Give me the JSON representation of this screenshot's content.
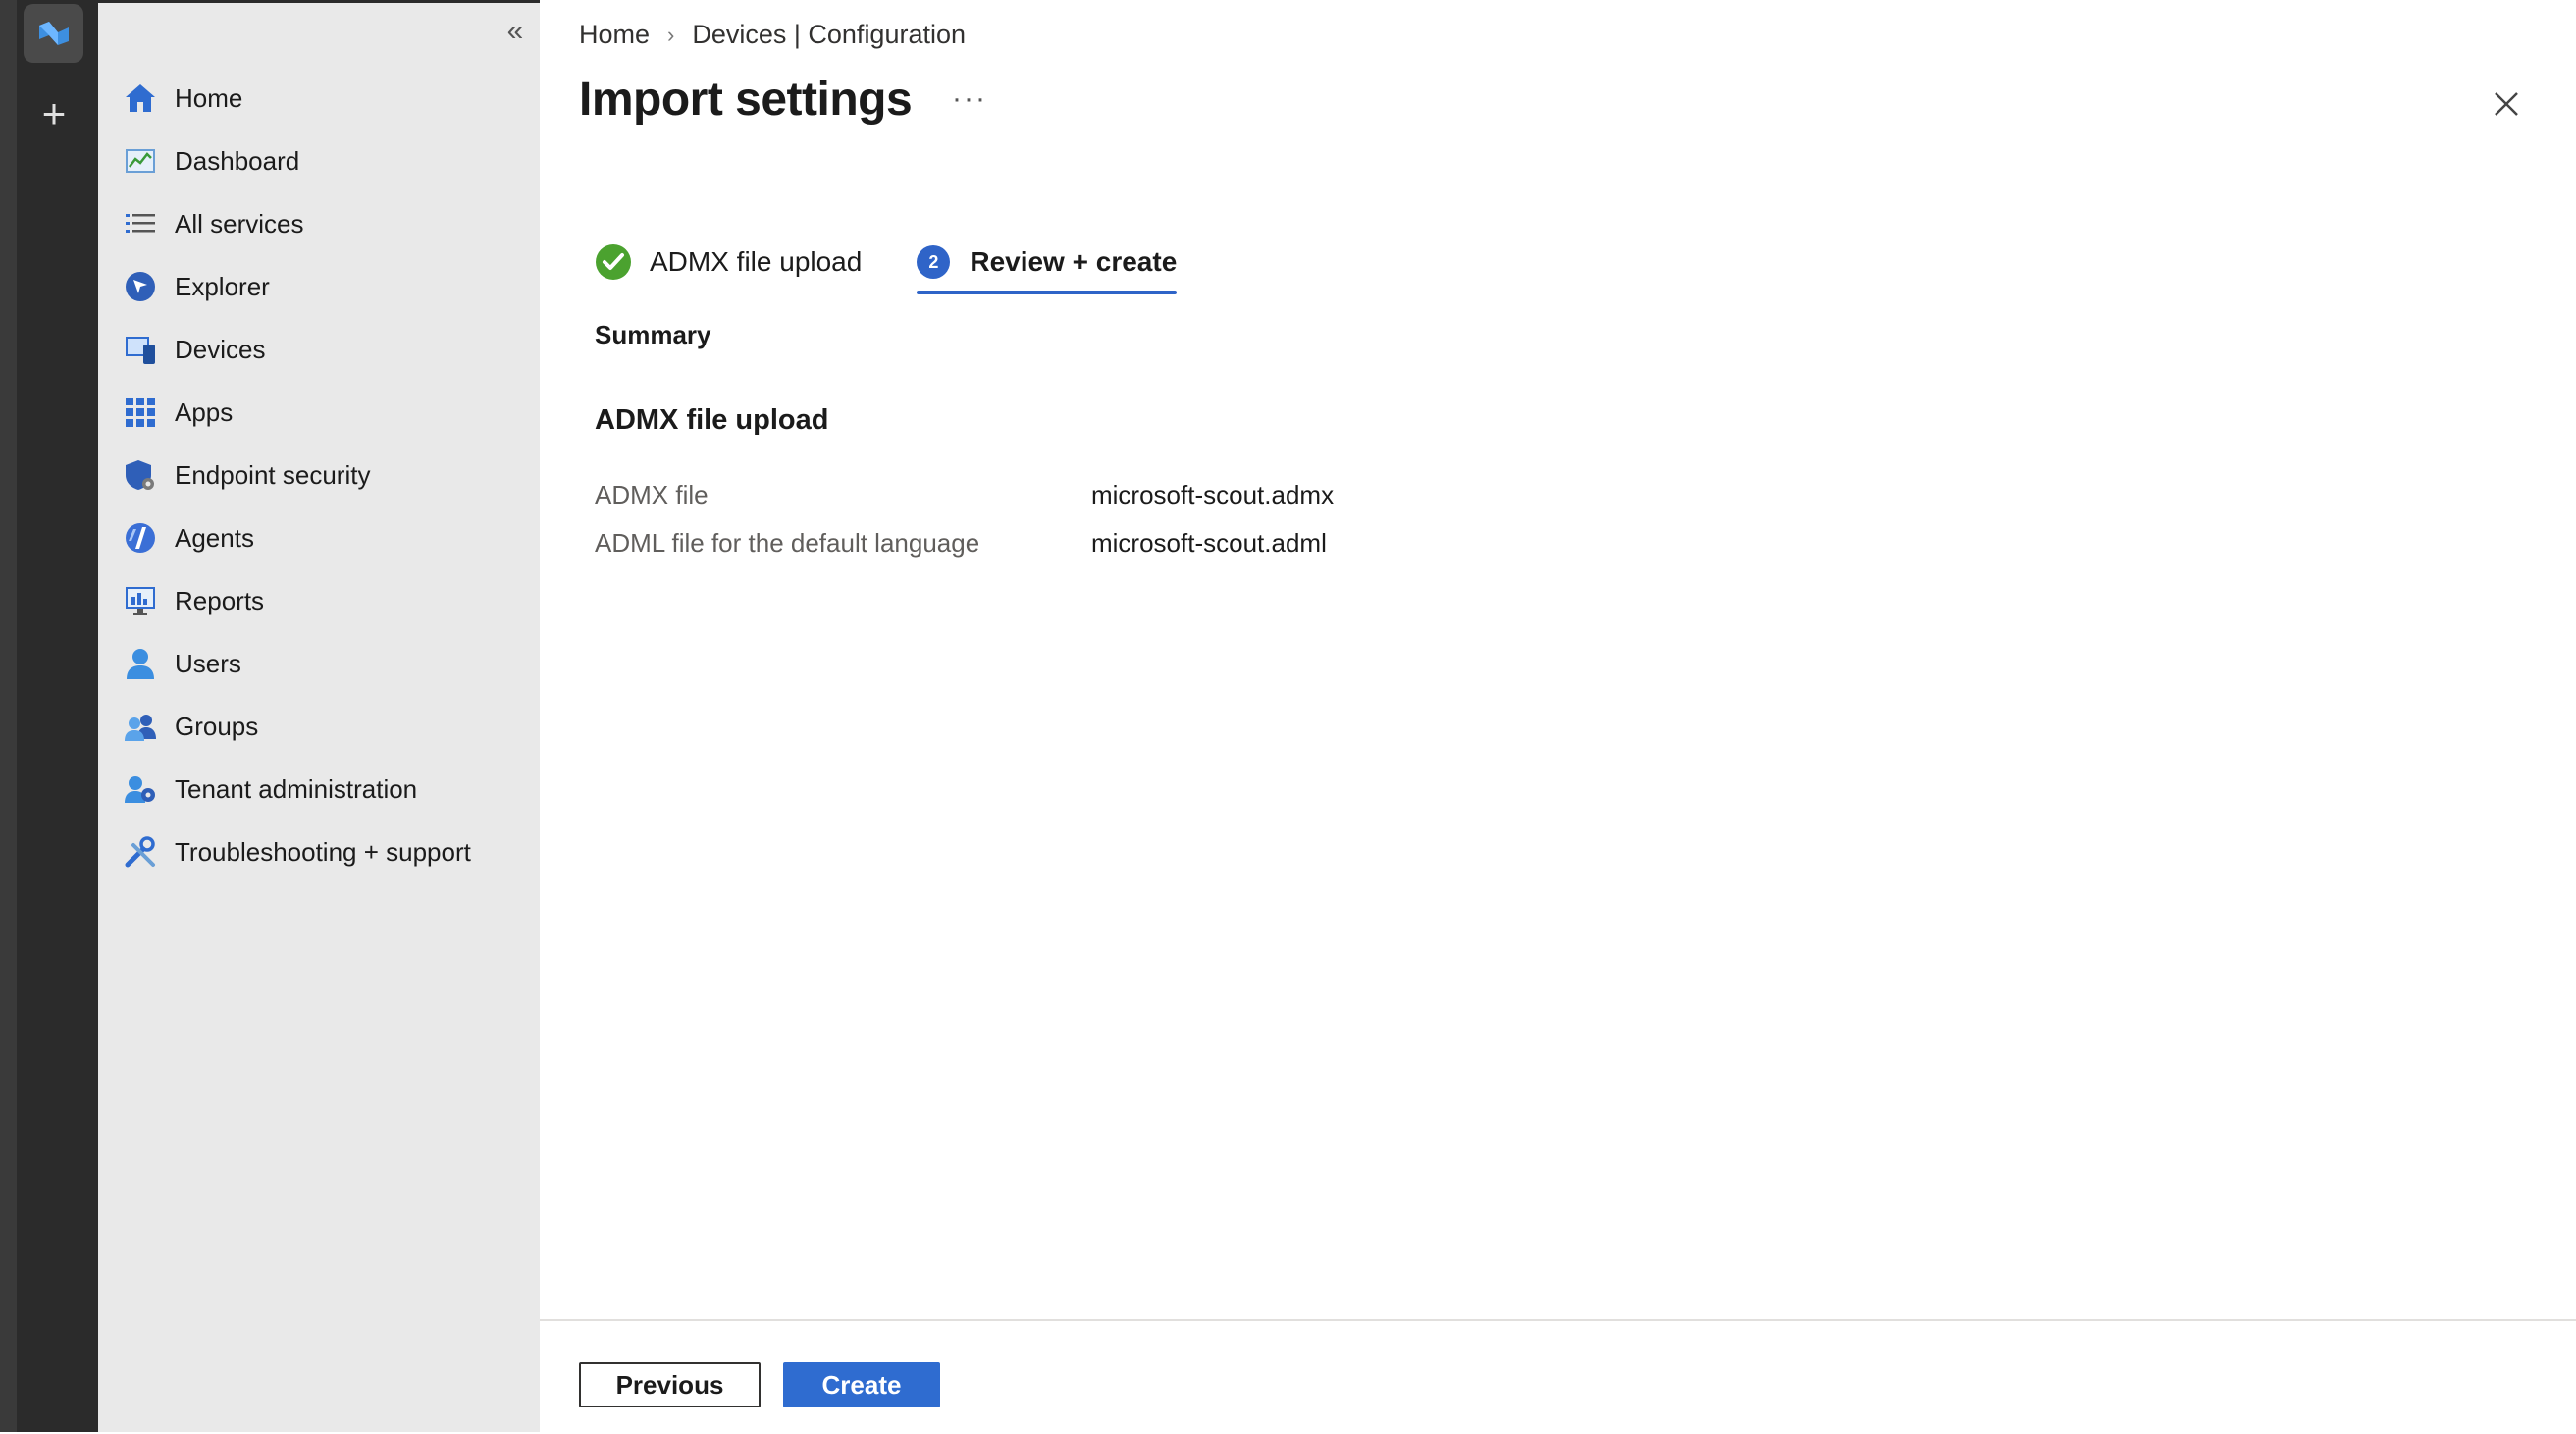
{
  "breadcrumb": {
    "home": "Home",
    "current": "Devices | Configuration"
  },
  "page": {
    "title": "Import settings",
    "more": "···"
  },
  "sidebar": {
    "items": [
      {
        "label": "Home",
        "icon": "home-icon"
      },
      {
        "label": "Dashboard",
        "icon": "dashboard-icon"
      },
      {
        "label": "All services",
        "icon": "list-icon"
      },
      {
        "label": "Explorer",
        "icon": "explorer-icon"
      },
      {
        "label": "Devices",
        "icon": "devices-icon"
      },
      {
        "label": "Apps",
        "icon": "apps-grid-icon"
      },
      {
        "label": "Endpoint security",
        "icon": "shield-icon"
      },
      {
        "label": "Agents",
        "icon": "agents-icon"
      },
      {
        "label": "Reports",
        "icon": "reports-icon"
      },
      {
        "label": "Users",
        "icon": "user-icon"
      },
      {
        "label": "Groups",
        "icon": "groups-icon"
      },
      {
        "label": "Tenant administration",
        "icon": "tenant-admin-icon"
      },
      {
        "label": "Troubleshooting + support",
        "icon": "tools-icon"
      }
    ]
  },
  "tabs": [
    {
      "label": "ADMX file upload",
      "status": "complete"
    },
    {
      "label": "Review + create",
      "step": "2",
      "status": "active"
    }
  ],
  "summary": {
    "heading": "Summary",
    "section_title": "ADMX file upload",
    "rows": [
      {
        "key": "ADMX file",
        "value": "microsoft-scout.admx"
      },
      {
        "key": "ADML file for the default language",
        "value": "microsoft-scout.adml"
      }
    ]
  },
  "footer": {
    "previous_label": "Previous",
    "create_label": "Create"
  },
  "colors": {
    "accent": "#2f64c8",
    "success": "#4ba22f",
    "sidebar_bg": "#e9e9e9"
  }
}
